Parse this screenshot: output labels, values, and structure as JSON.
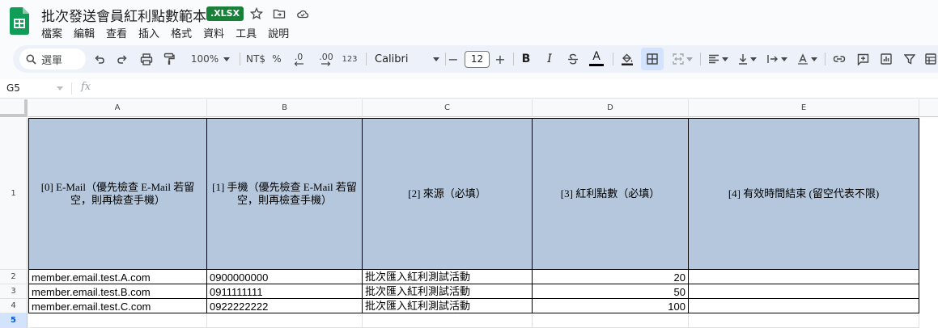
{
  "document": {
    "title": "批次發送會員紅利點數範本",
    "extension_badge": ".XLSX"
  },
  "menu": [
    "檔案",
    "編輯",
    "查看",
    "插入",
    "格式",
    "資料",
    "工具",
    "說明"
  ],
  "toolbar": {
    "search_label": "選單",
    "zoom": "100%",
    "currency": "NT$",
    "percent": "%",
    "decrease_decimal": ".0",
    "increase_decimal": ".00",
    "number_format": "123",
    "font_family": "Calibri",
    "font_size": "12",
    "minus": "−",
    "plus": "+",
    "bold": "B",
    "italic": "I",
    "text_color_letter": "A"
  },
  "formula_bar": {
    "cell_ref": "G5",
    "fx_label": "fx"
  },
  "sheet": {
    "columns": [
      "A",
      "B",
      "C",
      "D",
      "E"
    ],
    "row_numbers": [
      "1",
      "2",
      "3",
      "4",
      "5"
    ],
    "header_row": [
      "[0] E-Mail（優先檢查 E-Mail 若留空，則再檢查手機）",
      "[1] 手機（優先檢查 E-Mail 若留空，則再檢查手機）",
      "[2] 來源（必填）",
      "[3] 紅利點數（必填）",
      "[4] 有效時間結束 (留空代表不限)"
    ],
    "rows": [
      [
        "member.email.test.A.com",
        "0900000000",
        "批次匯入紅利測試活動",
        "20",
        ""
      ],
      [
        "member.email.test.B.com",
        "0911111111",
        "批次匯入紅利測試活動",
        "50",
        ""
      ],
      [
        "member.email.test.C.com",
        "0922222222",
        "批次匯入紅利測試活動",
        "100",
        ""
      ]
    ]
  },
  "colors": {
    "header_fill": "#b4c7dc",
    "sheets_green": "#188038",
    "toolbar_bg": "#edf2fa",
    "active_row": "#d3e3fd"
  }
}
